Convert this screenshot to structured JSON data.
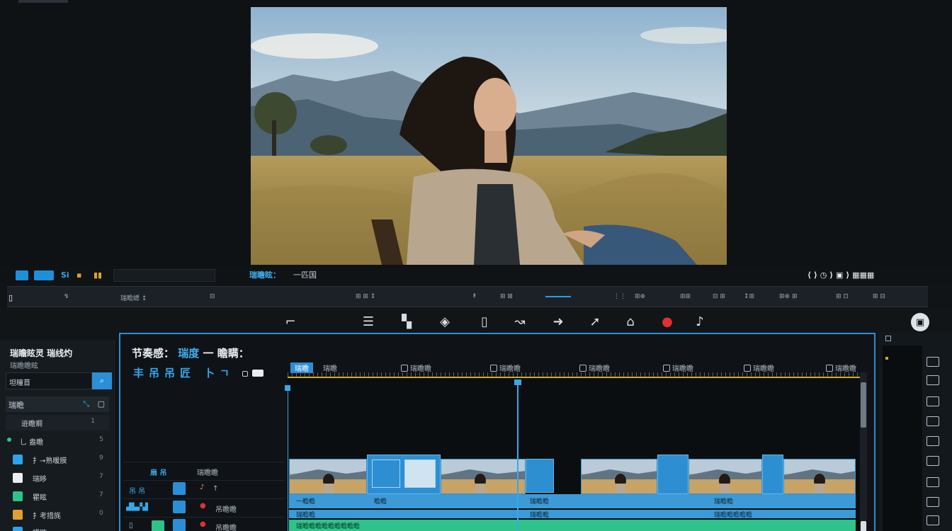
{
  "viewer": {
    "info_label": "瑞瞻眩：",
    "info_value": "一匹国",
    "right_controls": "⟨ ⟩  ◷  ⟩  ▣ ⟩  ▦▦▦"
  },
  "ruler_labels": [
    "▯",
    "↯",
    "瑞瞻蟋 ↕",
    "⊟",
    "⊞ ⊞ ↕",
    "↟",
    "⊞ ⊠",
    "⋮⋮",
    "⊞⊕",
    "⊞⊞",
    "⊟ ⊞",
    "↕⊞",
    "⊞⊕ ⊞",
    "⊞ ⊡",
    "⊞ ⊟"
  ],
  "toolbar": {
    "tools": [
      {
        "name": "split-icon",
        "glyph": "⌐"
      },
      {
        "name": "menu-lines-icon",
        "glyph": "☰"
      },
      {
        "name": "clip-icon",
        "glyph": "▚"
      },
      {
        "name": "diamond-icon",
        "glyph": "◈"
      },
      {
        "name": "crop-icon",
        "glyph": "▯"
      },
      {
        "name": "curve-icon",
        "glyph": "↝"
      },
      {
        "name": "speed-icon",
        "glyph": "➜"
      },
      {
        "name": "arrow-icon",
        "glyph": "➚"
      },
      {
        "name": "lock-icon",
        "glyph": "⌂"
      },
      {
        "name": "record-icon",
        "glyph": "●"
      },
      {
        "name": "mute-icon",
        "glyph": "♪"
      }
    ],
    "fullscreen_glyph": "▣"
  },
  "left_panel": {
    "title": "瑞瞻眩灵 瑞线灼",
    "subtitle": "瑞瞻瞻眩",
    "search_value": "坦瞳苜",
    "search_button": "⌕",
    "section_label": "瑞瞻",
    "items": [
      {
        "label": "䢠瞻赒",
        "value": "1"
      },
      {
        "label": "乚 盎瞻",
        "value": "5"
      },
      {
        "label": "扌→熟暖膜",
        "value": "9"
      },
      {
        "label": "瑞眵",
        "value": "7"
      },
      {
        "label": "瞿眩",
        "value": "7"
      },
      {
        "label": "扌考措旄",
        "value": "0"
      },
      {
        "label": "措眩",
        "value": "0"
      }
    ]
  },
  "timeline": {
    "title": "节奏感：",
    "title_accent": "瑞度",
    "title_rest": "一 瞻瞒：",
    "tools": [
      "丰",
      "吊",
      "吊",
      "匠",
      "卜",
      "ㄱ"
    ],
    "first_marker": "瑞瞻",
    "markers": [
      "瑞瞻",
      "瑞瞻瞻",
      "瑞瞻瞻",
      "瑞瞻瞻",
      "瑞瞻瞻",
      "瑞瞻瞻",
      "瑞瞻瞻"
    ],
    "track_label_1": "瑞瞻瞻",
    "track_label_2": "吊瞻瞻",
    "audio_labels": [
      "一瞻瞻",
      "瞻瞻",
      "瑞瞻瞻",
      "瑞瞻瞻",
      "瑞瞻瞻",
      "瑞瞻瞻",
      "瑞瞻瞻瞻瞻瞻"
    ],
    "green_label": "瑞瞻瞻瞻瞻瞻瞻瞻瞻瞻"
  },
  "colors": {
    "accent": "#2a8fd6",
    "playhead": "#36a8ec",
    "gold": "#d7a91d",
    "green": "#2fc28a",
    "record": "#e03030"
  }
}
